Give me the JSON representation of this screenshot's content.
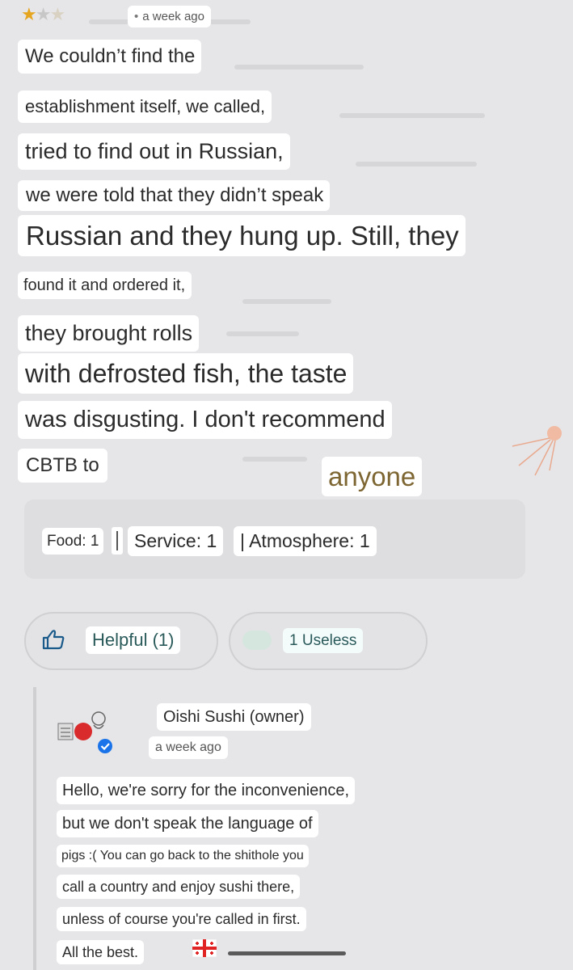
{
  "review": {
    "rating": 1,
    "rating_max": 3,
    "time": "a week ago",
    "lines": [
      "We couldn’t find the",
      "establishment itself, we called,",
      "tried to find out in Russian,",
      "we were told that they didn’t speak",
      "Russian and they hung up. Still, they",
      "found it and ordered it,",
      "they brought rolls",
      "with defrosted fish, the taste",
      "was disgusting. I don't recommend",
      "CBTB to",
      "anyone"
    ],
    "ratings": {
      "food": "Food: 1",
      "service": "Service: 1",
      "atmosphere": "| Atmosphere: 1"
    },
    "helpful_label": "Helpful (1)",
    "useless_label": "1 Useless"
  },
  "owner_reply": {
    "name": "Oishi Sushi (owner)",
    "time": "a week ago",
    "lines": [
      "Hello, we're sorry for the inconvenience,",
      "but we don't speak the language of",
      "pigs :( You can go back to the shithole you",
      "call a country and enjoy sushi there,",
      "unless of course you're called in first.",
      "All the best."
    ]
  },
  "icons": {
    "star": "star-icon",
    "thumb": "thumbs-up-icon",
    "verified": "verified-badge-icon",
    "flag": "georgia-flag-icon"
  },
  "colors": {
    "star_on": "#e6a51e",
    "accent_text": "#7d6632",
    "button_text": "#2a5a5a",
    "verified": "#1a73e8"
  }
}
